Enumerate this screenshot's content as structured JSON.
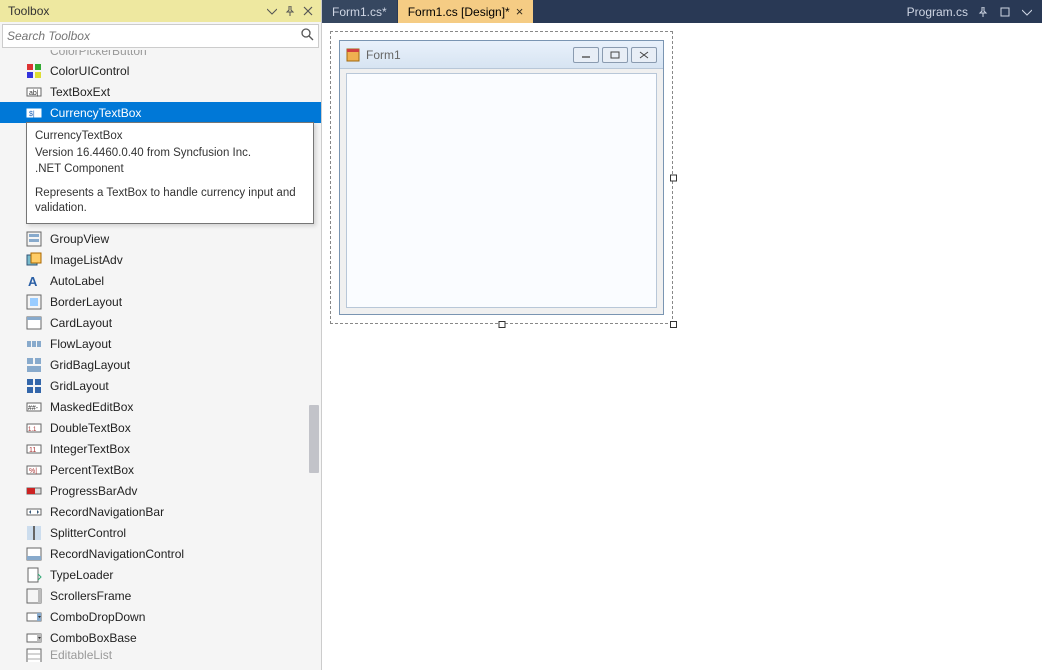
{
  "toolbox": {
    "title": "Toolbox",
    "searchPlaceholder": "Search Toolbox",
    "items": [
      {
        "label": "ColorUIControl",
        "icon": "grid-color"
      },
      {
        "label": "TextBoxExt",
        "icon": "textbox"
      },
      {
        "label": "CurrencyTextBox",
        "icon": "currency",
        "selected": true
      },
      {
        "label": "GroupView",
        "icon": "groupview"
      },
      {
        "label": "ImageListAdv",
        "icon": "imagelist"
      },
      {
        "label": "AutoLabel",
        "icon": "label"
      },
      {
        "label": "BorderLayout",
        "icon": "border"
      },
      {
        "label": "CardLayout",
        "icon": "card"
      },
      {
        "label": "FlowLayout",
        "icon": "flow"
      },
      {
        "label": "GridBagLayout",
        "icon": "gridbag"
      },
      {
        "label": "GridLayout",
        "icon": "gridlayout"
      },
      {
        "label": "MaskedEditBox",
        "icon": "masked"
      },
      {
        "label": "DoubleTextBox",
        "icon": "double"
      },
      {
        "label": "IntegerTextBox",
        "icon": "integer"
      },
      {
        "label": "PercentTextBox",
        "icon": "percent"
      },
      {
        "label": "ProgressBarAdv",
        "icon": "progress"
      },
      {
        "label": "RecordNavigationBar",
        "icon": "recordbar"
      },
      {
        "label": "SplitterControl",
        "icon": "splitter"
      },
      {
        "label": "RecordNavigationControl",
        "icon": "recordctrl"
      },
      {
        "label": "TypeLoader",
        "icon": "typeloader"
      },
      {
        "label": "ScrollersFrame",
        "icon": "scroller"
      },
      {
        "label": "ComboDropDown",
        "icon": "combo"
      },
      {
        "label": "ComboBoxBase",
        "icon": "combobase"
      },
      {
        "label": "EditableList",
        "icon": "editlist"
      }
    ],
    "partialTop": "ColorPickerButton"
  },
  "tooltip": {
    "head": "CurrencyTextBox",
    "version": "Version 16.4460.0.40 from Syncfusion Inc.",
    "type": ".NET Component",
    "desc": "Represents a TextBox to handle currency input and validation."
  },
  "tabs": {
    "left": [
      {
        "label": "Form1.cs*",
        "active": false
      },
      {
        "label": "Form1.cs [Design]*",
        "active": true,
        "closable": true
      }
    ],
    "rightLabel": "Program.cs"
  },
  "form": {
    "title": "Form1"
  }
}
